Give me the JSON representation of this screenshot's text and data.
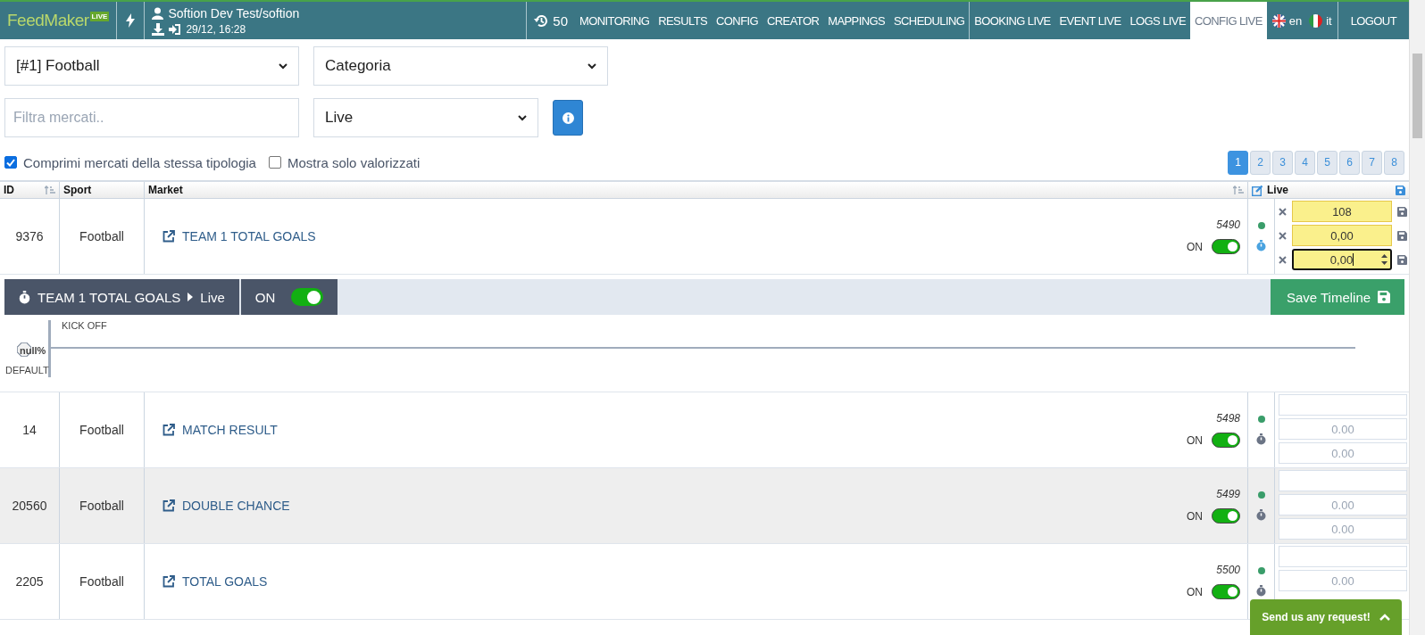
{
  "navbar": {
    "logo": "FeedMaker",
    "logo_badge": "LIVE",
    "user": "Softion Dev Test/softion",
    "login_time": "29/12, 16:28",
    "history_count": "50",
    "items": [
      {
        "label": "MONITORING",
        "selected": false
      },
      {
        "label": "RESULTS",
        "selected": false
      },
      {
        "label": "CONFIG",
        "selected": false
      },
      {
        "label": "CREATOR",
        "selected": false
      },
      {
        "label": "MAPPINGS",
        "selected": false
      },
      {
        "label": "SCHEDULING",
        "selected": false
      },
      {
        "label": "BOOKING LIVE",
        "selected": false
      },
      {
        "label": "EVENT LIVE",
        "selected": false
      },
      {
        "label": "LOGS LIVE",
        "selected": false
      },
      {
        "label": "CONFIG LIVE",
        "selected": true
      }
    ],
    "languages": [
      {
        "code": "en",
        "kind": "uk"
      },
      {
        "code": "it",
        "kind": "italy"
      }
    ],
    "logout": "LOGOUT"
  },
  "filters": {
    "sport": "[#1] Football",
    "category": "Categoria",
    "search_placeholder": "Filtra mercati..",
    "mode": "Live",
    "checkboxes": [
      {
        "label": "Comprimi mercati della stessa tipologia",
        "checked": true
      },
      {
        "label": "Mostra solo valorizzati",
        "checked": false
      }
    ]
  },
  "pages": [
    {
      "label": "1",
      "selected": true
    },
    {
      "label": "2",
      "selected": false
    },
    {
      "label": "3",
      "selected": false
    },
    {
      "label": "4",
      "selected": false
    },
    {
      "label": "5",
      "selected": false
    },
    {
      "label": "6",
      "selected": false
    },
    {
      "label": "7",
      "selected": false
    },
    {
      "label": "8",
      "selected": false
    }
  ],
  "table": {
    "columns": [
      "ID",
      "Sport",
      "Market",
      "Live"
    ],
    "rows": [
      {
        "id": "9376",
        "sport": "Football",
        "market": "TEAM 1 TOTAL GOALS",
        "code": "5490",
        "state": "ON",
        "on": true,
        "timeline_open": true,
        "inputs": [
          {
            "value": "108",
            "edited": true
          },
          {
            "value": "0,00",
            "edited": true
          },
          {
            "value": "0,00",
            "edited": true,
            "focused": true
          }
        ]
      },
      {
        "id": "14",
        "sport": "Football",
        "market": "MATCH RESULT",
        "code": "5498",
        "state": "ON",
        "on": true,
        "timeline_open": false,
        "inputs": [
          {
            "edited": false
          },
          {
            "placeholder": "0.00",
            "edited": false
          },
          {
            "placeholder": "0.00",
            "edited": false
          }
        ]
      },
      {
        "id": "20560",
        "sport": "Football",
        "market": "DOUBLE CHANCE",
        "code": "5499",
        "state": "ON",
        "on": true,
        "timeline_open": false,
        "inputs": [
          {
            "edited": false
          },
          {
            "placeholder": "0.00",
            "edited": false
          },
          {
            "placeholder": "0.00",
            "edited": false
          }
        ]
      },
      {
        "id": "2205",
        "sport": "Football",
        "market": "TOTAL GOALS",
        "code": "5500",
        "state": "ON",
        "on": true,
        "timeline_open": false,
        "inputs": [
          {
            "edited": false
          },
          {
            "placeholder": "0.00",
            "edited": false
          }
        ]
      }
    ]
  },
  "timeline": {
    "market": "TEAM 1 TOTAL GOALS",
    "mode": "Live",
    "state": "ON",
    "on": true,
    "save": "Save Timeline",
    "marker": "KICK OFF",
    "percent": "null%",
    "default": "DEFAULT"
  },
  "feedback": "Send us any request!"
}
